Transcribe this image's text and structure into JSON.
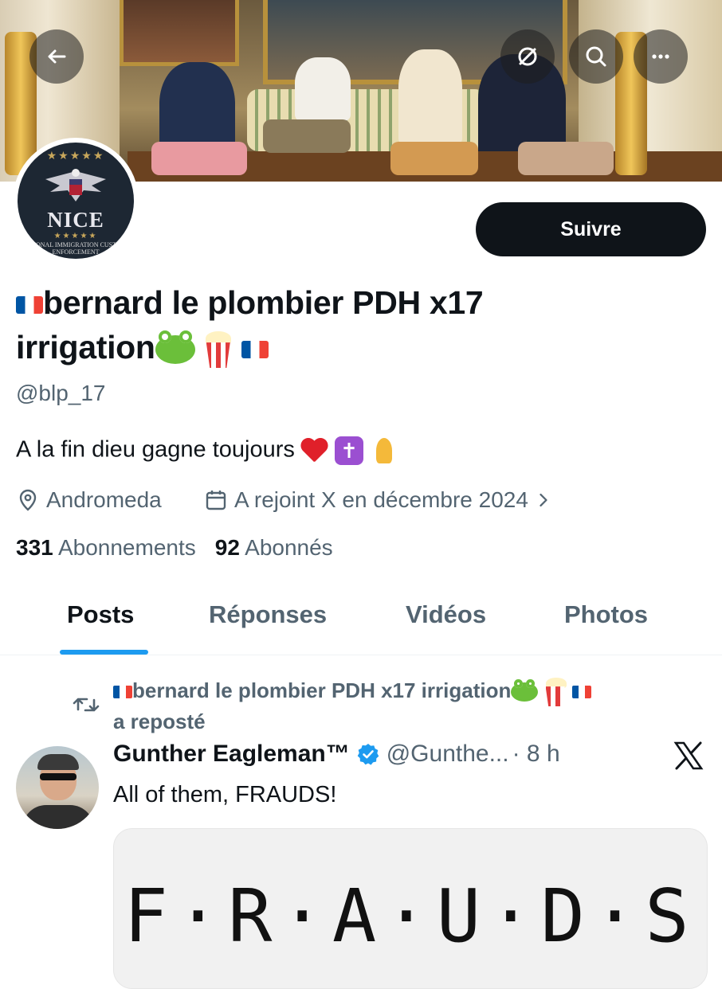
{
  "banner": {
    "back_icon": "arrow-left-icon",
    "action_icons": [
      "grok-slash-icon",
      "search-icon",
      "more-dots-icon"
    ]
  },
  "profile": {
    "avatar_text": "NICE",
    "avatar_sub": "NATIONAL IMMIGRATION CUSTOMS ENFORCEMENT",
    "follow_label": "Suivre",
    "name_part1": "bernard le plombier PDH x17",
    "name_part2": "irrigation",
    "handle": "@blp_17",
    "bio": "A la fin dieu gagne toujours",
    "location": "Andromeda",
    "joined": "A rejoint X en décembre 2024",
    "following_count": "331",
    "following_label": "Abonnements",
    "followers_count": "92",
    "followers_label": "Abonnés"
  },
  "tabs": [
    {
      "label": "Posts",
      "active": true
    },
    {
      "label": "Réponses",
      "active": false
    },
    {
      "label": "Vidéos",
      "active": false
    },
    {
      "label": "Photos",
      "active": false
    }
  ],
  "post": {
    "repost_name": "bernard le plombier PDH x17 irrigation",
    "repost_suffix": "a reposté",
    "author_name": "Gunther Eagleman™",
    "author_handle": "@Gunthe...",
    "time": "· 8 h",
    "text": "All of them, FRAUDS!",
    "media_text": "F·R·A·U·D·S",
    "media_letters": [
      "F",
      "R",
      "A",
      "U",
      "D",
      "S"
    ]
  },
  "colors": {
    "accent": "#1d9bf0",
    "text_primary": "#0f1419",
    "text_secondary": "#536471",
    "follow_bg": "#0f1419"
  }
}
